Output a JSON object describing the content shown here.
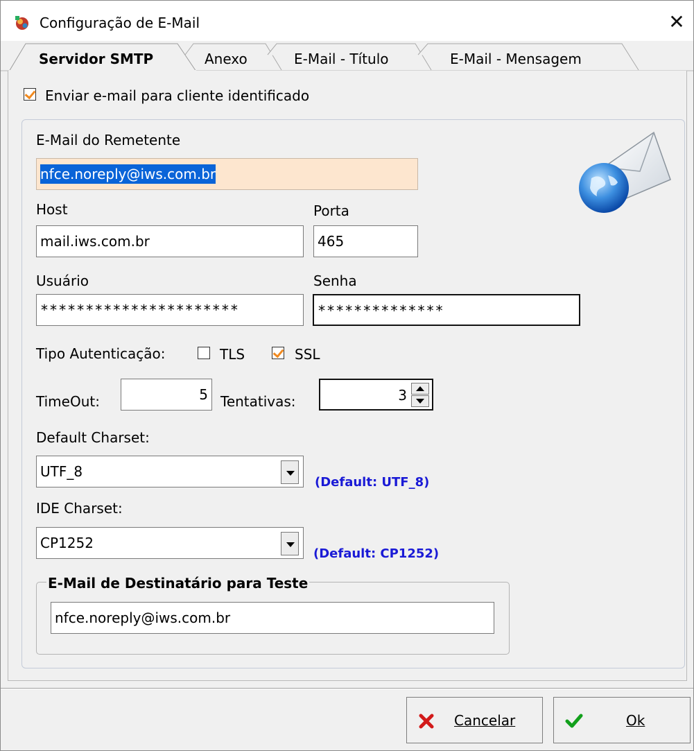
{
  "window": {
    "title": "Configuração de E-Mail",
    "close_label": "✕"
  },
  "tabs": [
    {
      "label": "Servidor SMTP",
      "active": true
    },
    {
      "label": "Anexo",
      "active": false
    },
    {
      "label": "E-Mail - Título",
      "active": false
    },
    {
      "label": "E-Mail - Mensagem",
      "active": false
    }
  ],
  "smtp": {
    "send_to_client_label": "Enviar e-mail para cliente identificado",
    "send_to_client_checked": true,
    "sender_label": "E-Mail do Remetente",
    "sender_value": "nfce.noreply@iws.com.br",
    "host_label": "Host",
    "host_value": "mail.iws.com.br",
    "port_label": "Porta",
    "port_value": "465",
    "user_label": "Usuário",
    "user_value": "**********************",
    "password_label": "Senha",
    "password_value": "**************",
    "auth_label": "Tipo Autenticação:",
    "tls_label": "TLS",
    "tls_checked": false,
    "ssl_label": "SSL",
    "ssl_checked": true,
    "timeout_label": "TimeOut:",
    "timeout_value": "5",
    "attempts_label": "Tentativas:",
    "attempts_value": "3",
    "default_charset_label": "Default Charset:",
    "default_charset_value": "UTF_8",
    "default_charset_hint": "(Default: UTF_8)",
    "ide_charset_label": "IDE Charset:",
    "ide_charset_value": "CP1252",
    "ide_charset_hint": "(Default: CP1252)"
  },
  "test_recipient": {
    "legend": "E-Mail de Destinatário para Teste",
    "value": "nfce.noreply@iws.com.br"
  },
  "buttons": {
    "cancel_label": "Cancelar",
    "ok_label": "Ok"
  },
  "colors": {
    "accent_check": "#f0891f",
    "hint_blue": "#1a1ad6",
    "selection": "#0a64d8",
    "sender_bg": "#fde6cf"
  }
}
